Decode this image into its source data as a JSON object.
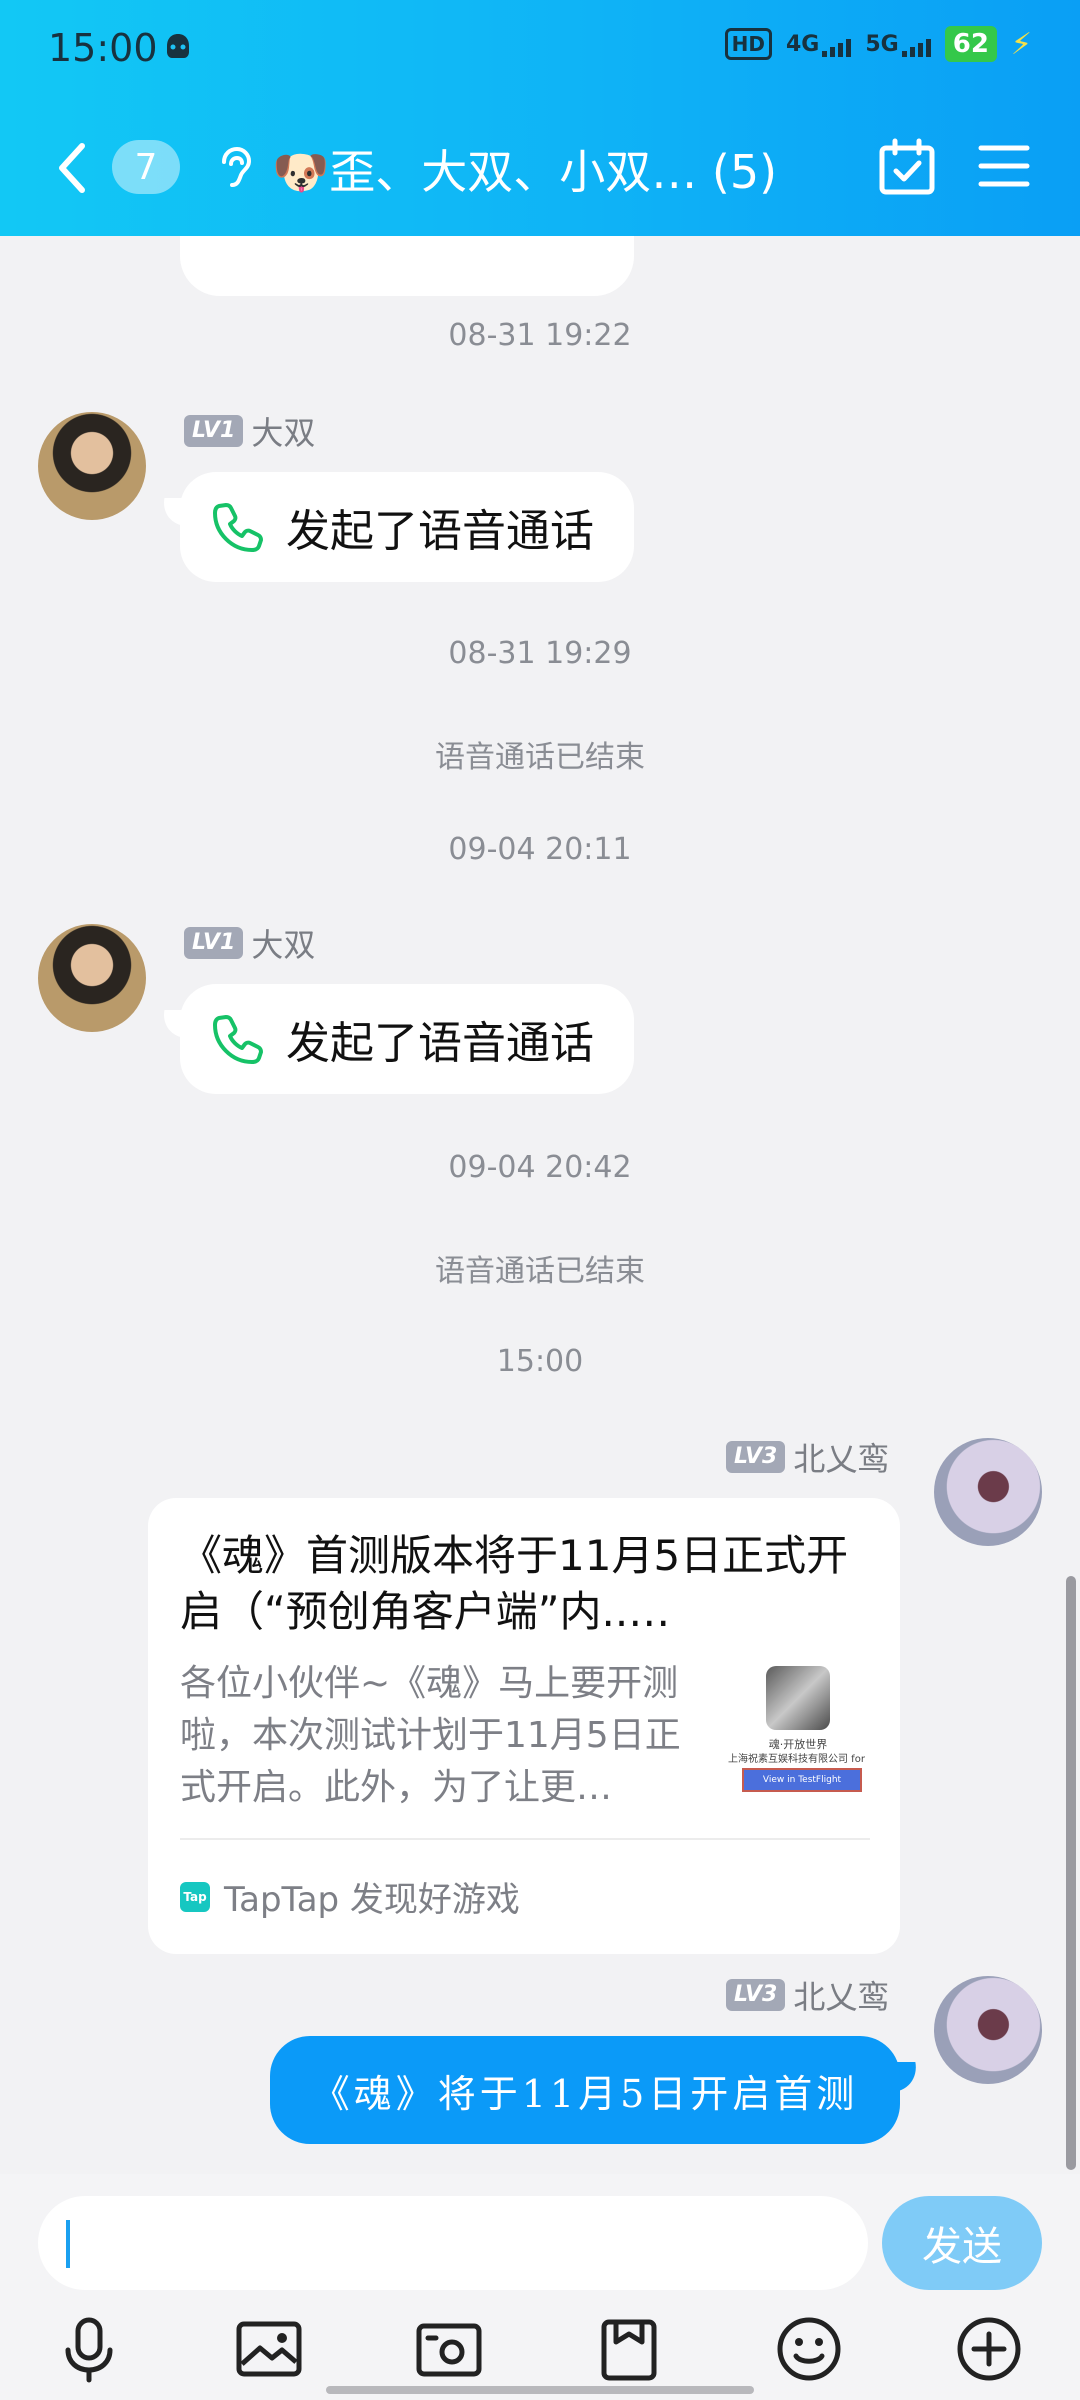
{
  "status_bar": {
    "time": "15:00",
    "hd": "HD",
    "network_4g": "4G",
    "network_5g": "5G",
    "battery": "62"
  },
  "header": {
    "unread_count": "7",
    "title": "🐶歪、大双、小双… (5)"
  },
  "messages": [
    {
      "type": "time",
      "text": "08-31 19:22"
    },
    {
      "type": "call",
      "level": "LV1",
      "sender": "大双",
      "text": "发起了语音通话"
    },
    {
      "type": "time",
      "text": "08-31 19:29"
    },
    {
      "type": "system",
      "text": "语音通话已结束"
    },
    {
      "type": "time",
      "text": "09-04 20:11"
    },
    {
      "type": "call",
      "level": "LV1",
      "sender": "大双",
      "text": "发起了语音通话"
    },
    {
      "type": "time",
      "text": "09-04 20:42"
    },
    {
      "type": "system",
      "text": "语音通话已结束"
    },
    {
      "type": "time",
      "text": "15:00"
    },
    {
      "type": "card",
      "level": "LV3",
      "sender": "北乂鸾",
      "title": "《魂》首测版本将于11月5日正式开启（“预创角客户端”内..…",
      "description": "各位小伙伴~《魂》马上要开测啦，本次测试计划于11月5日正式开启。此外，为了让更…",
      "thumb_line1": "魂·开放世界",
      "thumb_line2": "上海祝素互娱科技有限公司 for i",
      "thumb_button": "View in TestFlight",
      "source_icon": "Tap",
      "source": "TapTap 发现好游戏"
    },
    {
      "type": "text",
      "level": "LV3",
      "sender": "北乂鸾",
      "text": "《魂》将于11月5日开启首测"
    }
  ],
  "input": {
    "value": "",
    "send_label": "发送"
  },
  "toolbar": [
    "mic-icon",
    "image-icon",
    "camera-icon",
    "file-icon",
    "emoji-icon",
    "plus-icon"
  ]
}
